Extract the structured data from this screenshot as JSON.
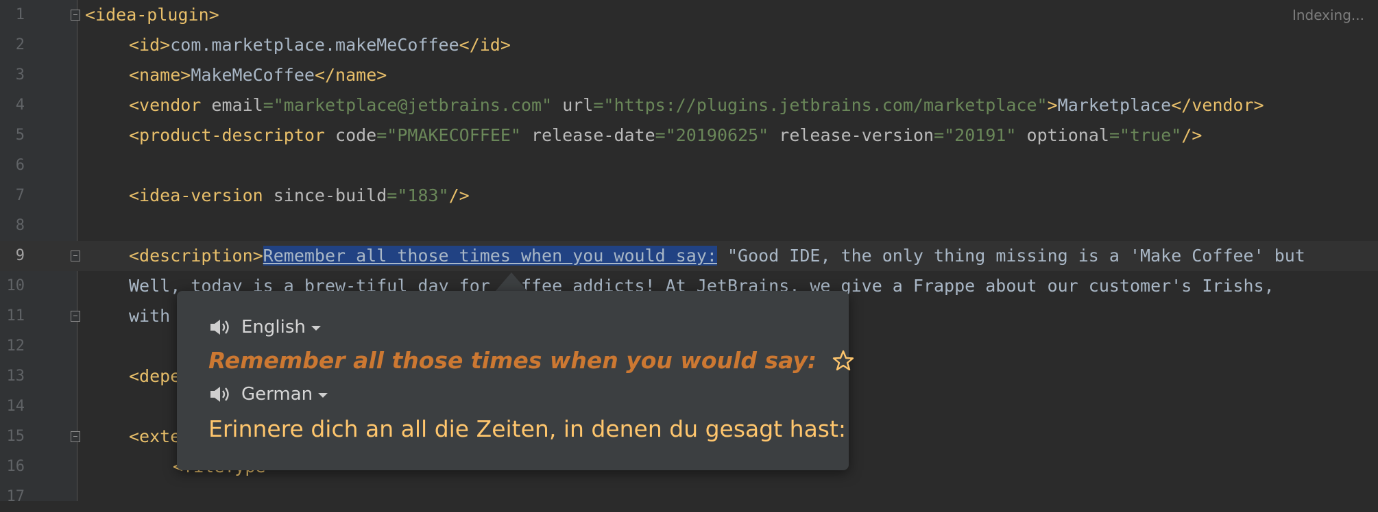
{
  "status": {
    "indexing": "Indexing..."
  },
  "editor": {
    "line_numbers": [
      "1",
      "2",
      "3",
      "4",
      "5",
      "6",
      "7",
      "8",
      "9",
      "10",
      "11",
      "12",
      "13",
      "14",
      "15",
      "16",
      "17"
    ],
    "lines": [
      {
        "segments": [
          {
            "c": "t",
            "s": "<idea-plugin>"
          }
        ]
      },
      {
        "segments": [
          {
            "c": "t",
            "s": "<id>"
          },
          {
            "c": "x",
            "s": "com.marketplace.makeMeCoffee"
          },
          {
            "c": "t",
            "s": "</id>"
          }
        ]
      },
      {
        "segments": [
          {
            "c": "t",
            "s": "<name>"
          },
          {
            "c": "x",
            "s": "MakeMeCoffee"
          },
          {
            "c": "t",
            "s": "</name>"
          }
        ]
      },
      {
        "segments": [
          {
            "c": "t",
            "s": "<vendor "
          },
          {
            "c": "a",
            "s": "email"
          },
          {
            "c": "v",
            "s": "=\"marketplace@jetbrains.com\" "
          },
          {
            "c": "a",
            "s": "url"
          },
          {
            "c": "v",
            "s": "=\"https://plugins.jetbrains.com/marketplace\""
          },
          {
            "c": "t",
            "s": ">"
          },
          {
            "c": "x",
            "s": "Marketplace"
          },
          {
            "c": "t",
            "s": "</vendor>"
          }
        ]
      },
      {
        "segments": [
          {
            "c": "t",
            "s": "<product-descriptor "
          },
          {
            "c": "a",
            "s": "code"
          },
          {
            "c": "v",
            "s": "=\"PMAKECOFFEE\" "
          },
          {
            "c": "a",
            "s": "release-date"
          },
          {
            "c": "v",
            "s": "=\"20190625\" "
          },
          {
            "c": "a",
            "s": "release-version"
          },
          {
            "c": "v",
            "s": "=\"20191\" "
          },
          {
            "c": "a",
            "s": "optional"
          },
          {
            "c": "v",
            "s": "=\"true\""
          },
          {
            "c": "t",
            "s": "/>"
          }
        ]
      },
      {
        "segments": []
      },
      {
        "segments": [
          {
            "c": "t",
            "s": "<idea-version "
          },
          {
            "c": "a",
            "s": "since-build"
          },
          {
            "c": "v",
            "s": "=\"183\""
          },
          {
            "c": "t",
            "s": "/>"
          }
        ]
      },
      {
        "segments": []
      },
      {
        "segments": [
          {
            "c": "t",
            "s": "<description>"
          },
          {
            "c": "x sel",
            "s": "Remember all those times when you would say:"
          },
          {
            "c": "x",
            "s": " \"Good IDE, the only thing missing is a 'Make Coffee' but"
          }
        ]
      },
      {
        "segments": [
          {
            "c": "x",
            "s": "Well, today is a brew-tiful day for coffee addicts! At JetBrains, we give a Frappe about our customer's Irishs,"
          }
        ]
      },
      {
        "segments": [
          {
            "c": "x",
            "s": "with a Caramel-Skinny-Vanilla-de-caff-Macchiato right from"
          }
        ]
      },
      {
        "segments": []
      },
      {
        "segments": [
          {
            "c": "t",
            "s": "<depends>"
          }
        ]
      },
      {
        "segments": []
      },
      {
        "segments": [
          {
            "c": "t",
            "s": "<extensions>"
          }
        ]
      },
      {
        "segments": [
          {
            "c": "t",
            "s": "<fileType"
          }
        ]
      },
      {
        "segments": []
      }
    ]
  },
  "popup": {
    "source_language": "English",
    "source_text": "Remember all those times when you would say:",
    "target_language": "German",
    "target_text": "Erinnere dich an all die Zeiten, in denen du gesagt hast:"
  }
}
